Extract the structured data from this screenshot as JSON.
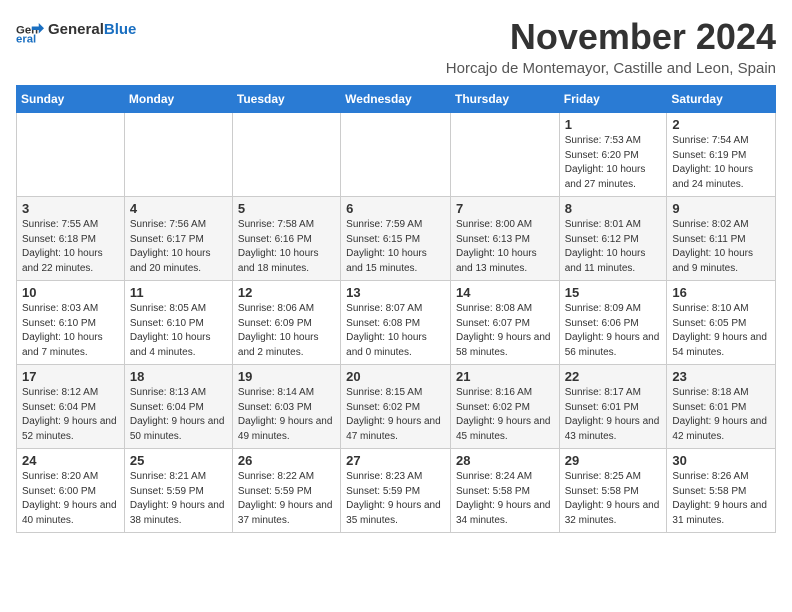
{
  "logo": {
    "general": "General",
    "blue": "Blue"
  },
  "title": "November 2024",
  "subtitle": "Horcajo de Montemayor, Castille and Leon, Spain",
  "days_header": [
    "Sunday",
    "Monday",
    "Tuesday",
    "Wednesday",
    "Thursday",
    "Friday",
    "Saturday"
  ],
  "weeks": [
    [
      {
        "day": "",
        "info": ""
      },
      {
        "day": "",
        "info": ""
      },
      {
        "day": "",
        "info": ""
      },
      {
        "day": "",
        "info": ""
      },
      {
        "day": "",
        "info": ""
      },
      {
        "day": "1",
        "info": "Sunrise: 7:53 AM\nSunset: 6:20 PM\nDaylight: 10 hours and 27 minutes."
      },
      {
        "day": "2",
        "info": "Sunrise: 7:54 AM\nSunset: 6:19 PM\nDaylight: 10 hours and 24 minutes."
      }
    ],
    [
      {
        "day": "3",
        "info": "Sunrise: 7:55 AM\nSunset: 6:18 PM\nDaylight: 10 hours and 22 minutes."
      },
      {
        "day": "4",
        "info": "Sunrise: 7:56 AM\nSunset: 6:17 PM\nDaylight: 10 hours and 20 minutes."
      },
      {
        "day": "5",
        "info": "Sunrise: 7:58 AM\nSunset: 6:16 PM\nDaylight: 10 hours and 18 minutes."
      },
      {
        "day": "6",
        "info": "Sunrise: 7:59 AM\nSunset: 6:15 PM\nDaylight: 10 hours and 15 minutes."
      },
      {
        "day": "7",
        "info": "Sunrise: 8:00 AM\nSunset: 6:13 PM\nDaylight: 10 hours and 13 minutes."
      },
      {
        "day": "8",
        "info": "Sunrise: 8:01 AM\nSunset: 6:12 PM\nDaylight: 10 hours and 11 minutes."
      },
      {
        "day": "9",
        "info": "Sunrise: 8:02 AM\nSunset: 6:11 PM\nDaylight: 10 hours and 9 minutes."
      }
    ],
    [
      {
        "day": "10",
        "info": "Sunrise: 8:03 AM\nSunset: 6:10 PM\nDaylight: 10 hours and 7 minutes."
      },
      {
        "day": "11",
        "info": "Sunrise: 8:05 AM\nSunset: 6:10 PM\nDaylight: 10 hours and 4 minutes."
      },
      {
        "day": "12",
        "info": "Sunrise: 8:06 AM\nSunset: 6:09 PM\nDaylight: 10 hours and 2 minutes."
      },
      {
        "day": "13",
        "info": "Sunrise: 8:07 AM\nSunset: 6:08 PM\nDaylight: 10 hours and 0 minutes."
      },
      {
        "day": "14",
        "info": "Sunrise: 8:08 AM\nSunset: 6:07 PM\nDaylight: 9 hours and 58 minutes."
      },
      {
        "day": "15",
        "info": "Sunrise: 8:09 AM\nSunset: 6:06 PM\nDaylight: 9 hours and 56 minutes."
      },
      {
        "day": "16",
        "info": "Sunrise: 8:10 AM\nSunset: 6:05 PM\nDaylight: 9 hours and 54 minutes."
      }
    ],
    [
      {
        "day": "17",
        "info": "Sunrise: 8:12 AM\nSunset: 6:04 PM\nDaylight: 9 hours and 52 minutes."
      },
      {
        "day": "18",
        "info": "Sunrise: 8:13 AM\nSunset: 6:04 PM\nDaylight: 9 hours and 50 minutes."
      },
      {
        "day": "19",
        "info": "Sunrise: 8:14 AM\nSunset: 6:03 PM\nDaylight: 9 hours and 49 minutes."
      },
      {
        "day": "20",
        "info": "Sunrise: 8:15 AM\nSunset: 6:02 PM\nDaylight: 9 hours and 47 minutes."
      },
      {
        "day": "21",
        "info": "Sunrise: 8:16 AM\nSunset: 6:02 PM\nDaylight: 9 hours and 45 minutes."
      },
      {
        "day": "22",
        "info": "Sunrise: 8:17 AM\nSunset: 6:01 PM\nDaylight: 9 hours and 43 minutes."
      },
      {
        "day": "23",
        "info": "Sunrise: 8:18 AM\nSunset: 6:01 PM\nDaylight: 9 hours and 42 minutes."
      }
    ],
    [
      {
        "day": "24",
        "info": "Sunrise: 8:20 AM\nSunset: 6:00 PM\nDaylight: 9 hours and 40 minutes."
      },
      {
        "day": "25",
        "info": "Sunrise: 8:21 AM\nSunset: 5:59 PM\nDaylight: 9 hours and 38 minutes."
      },
      {
        "day": "26",
        "info": "Sunrise: 8:22 AM\nSunset: 5:59 PM\nDaylight: 9 hours and 37 minutes."
      },
      {
        "day": "27",
        "info": "Sunrise: 8:23 AM\nSunset: 5:59 PM\nDaylight: 9 hours and 35 minutes."
      },
      {
        "day": "28",
        "info": "Sunrise: 8:24 AM\nSunset: 5:58 PM\nDaylight: 9 hours and 34 minutes."
      },
      {
        "day": "29",
        "info": "Sunrise: 8:25 AM\nSunset: 5:58 PM\nDaylight: 9 hours and 32 minutes."
      },
      {
        "day": "30",
        "info": "Sunrise: 8:26 AM\nSunset: 5:58 PM\nDaylight: 9 hours and 31 minutes."
      }
    ]
  ]
}
